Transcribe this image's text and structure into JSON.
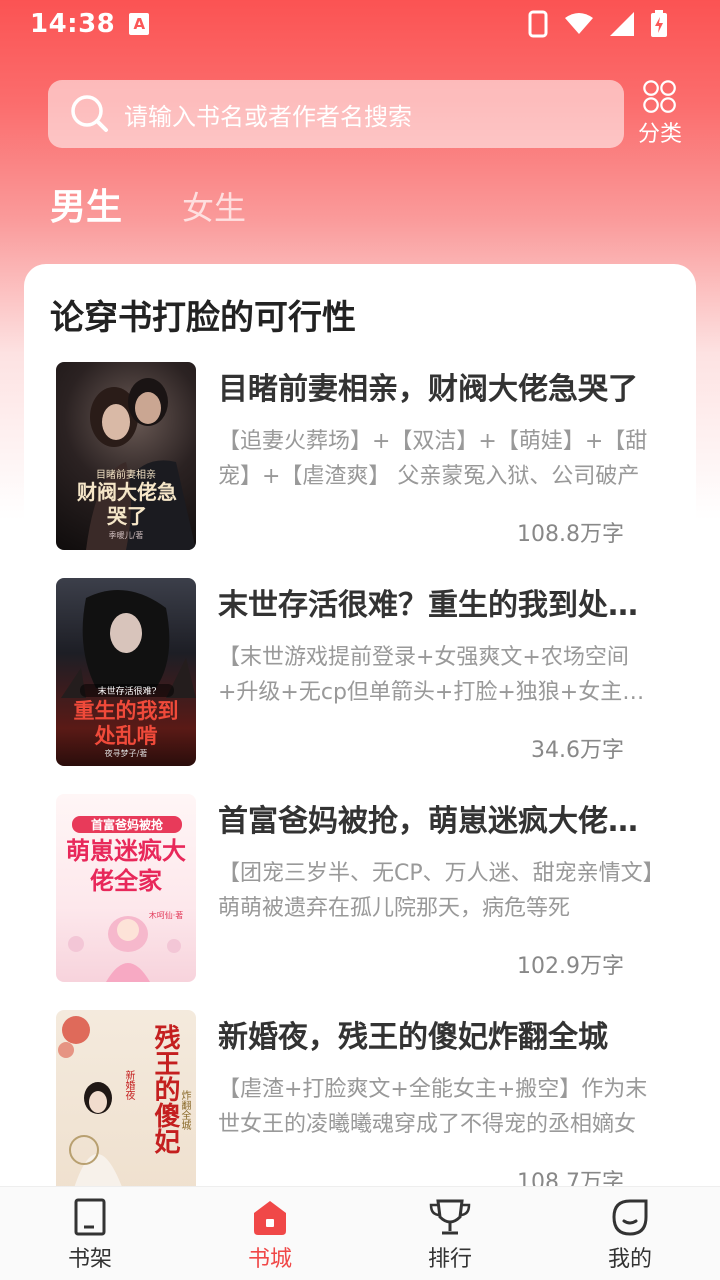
{
  "status": {
    "time": "14:38",
    "badge": "A"
  },
  "search": {
    "placeholder": "请输入书名或者作者名搜索"
  },
  "category": {
    "label": "分类"
  },
  "gender_tabs": {
    "male": "男生",
    "female": "女生"
  },
  "section": {
    "title": "论穿书打脸的可行性"
  },
  "books": [
    {
      "title": "目睹前妻相亲，财阀大佬急哭了",
      "desc": "【追妻火葬场】+【双洁】+【萌娃】+【甜宠】+【虐渣爽】 父亲蒙冤入狱、公司破产",
      "words": "108.8万字",
      "cover_main": "财阀大佬急哭了",
      "cover_sub": "目睹前妻相亲",
      "cover_author": "季暖儿/著"
    },
    {
      "title": "末世存活很难？重生的我到处乱啃",
      "desc": "【末世游戏提前登录+女强爽文+农场空间+升级+无cp但单箭头+打脸+独狼+女主疯批】",
      "words": "34.6万字",
      "cover_main": "重生的我到处乱啃",
      "cover_sub": "末世存活很难?",
      "cover_author": "夜寻梦子/著"
    },
    {
      "title": "首富爸妈被抢，萌崽迷疯大佬全家",
      "desc": "【团宠三岁半、无CP、万人迷、甜宠亲情文】萌萌被遗弃在孤儿院那天，病危等死",
      "words": "102.9万字",
      "cover_main": "萌崽迷疯大佬全家",
      "cover_sub": "首富爸妈被抢",
      "cover_author": "木呵仙·著"
    },
    {
      "title": "新婚夜，残王的傻妃炸翻全城",
      "desc": "【虐渣+打脸爽文+全能女主+搬空】作为末世女王的凌曦曦魂穿成了不得宠的丞相嫡女",
      "words": "108.7万字",
      "cover_main": "残王的傻妃",
      "cover_sub": "炸翻全城",
      "cover_author": "新婚夜"
    }
  ],
  "tabbar": [
    {
      "label": "书架",
      "icon": "bookshelf-icon"
    },
    {
      "label": "书城",
      "icon": "bookstore-icon"
    },
    {
      "label": "排行",
      "icon": "trophy-icon"
    },
    {
      "label": "我的",
      "icon": "profile-icon"
    }
  ],
  "colors": {
    "accent": "#f04848",
    "gradient_top": "#fb5353"
  }
}
